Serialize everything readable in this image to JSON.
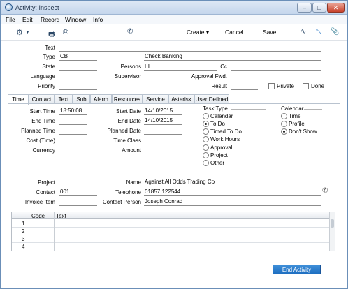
{
  "window": {
    "title": "Activity: Inspect"
  },
  "menu": [
    "File",
    "Edit",
    "Record",
    "Window",
    "Info"
  ],
  "toolbar": {
    "create": "Create",
    "cancel": "Cancel",
    "save": "Save"
  },
  "header": {
    "text_label": "Text",
    "text_value": "",
    "type_label": "Type",
    "type_value": "CB",
    "type_desc": "Check Banking",
    "state_label": "State",
    "state_value": "",
    "persons_label": "Persons",
    "persons_value": "FF",
    "cc_label": "Cc",
    "cc_value": "",
    "language_label": "Language",
    "language_value": "",
    "supervisor_label": "Supervisor",
    "supervisor_value": "",
    "approval_label": "Approval Fwd.",
    "approval_value": "",
    "priority_label": "Priority",
    "priority_value": "",
    "result_label": "Result",
    "result_value": "",
    "private_label": "Private",
    "done_label": "Done"
  },
  "tabs": [
    "Time",
    "Contact",
    "Text",
    "Sub",
    "Alarm",
    "Resources",
    "Service",
    "Asterisk",
    "User Defined"
  ],
  "time": {
    "start_time_label": "Start Time",
    "start_time": "18:50:08",
    "end_time_label": "End Time",
    "end_time": "",
    "planned_time_label": "Planned Time",
    "planned_time": "",
    "cost_label": "Cost (Time)",
    "cost": "",
    "currency_label": "Currency",
    "currency": "",
    "start_date_label": "Start Date",
    "start_date": "14/10/2015",
    "end_date_label": "End Date",
    "end_date": "14/10/2015",
    "planned_date_label": "Planned Date",
    "planned_date": "",
    "time_class_label": "Time Class",
    "time_class": "",
    "amount_label": "Amount",
    "amount": ""
  },
  "task_type": {
    "title": "Task Type",
    "options": [
      "Calendar",
      "To Do",
      "Timed To Do",
      "Work Hours",
      "Approval",
      "Project",
      "Other"
    ],
    "selected": "To Do"
  },
  "calendar": {
    "title": "Calendar",
    "options": [
      "Time",
      "Profile",
      "Don't Show"
    ],
    "selected": "Don't Show"
  },
  "footer": {
    "project_label": "Project",
    "project": "",
    "contact_label": "Contact",
    "contact": "001",
    "invoice_label": "Invoice Item",
    "invoice": "",
    "name_label": "Name",
    "name": "Against All Odds Trading Co",
    "telephone_label": "Telephone",
    "telephone": "01857 122544",
    "contact_person_label": "Contact Person",
    "contact_person": "Joseph Conrad"
  },
  "grid": {
    "headers": [
      "Code",
      "Text"
    ],
    "rows": [
      "1",
      "2",
      "3",
      "4"
    ]
  },
  "end_button": "End Activity",
  "colors": {
    "accent": "#1e6fc1",
    "window_border": "#6b8fb8"
  }
}
